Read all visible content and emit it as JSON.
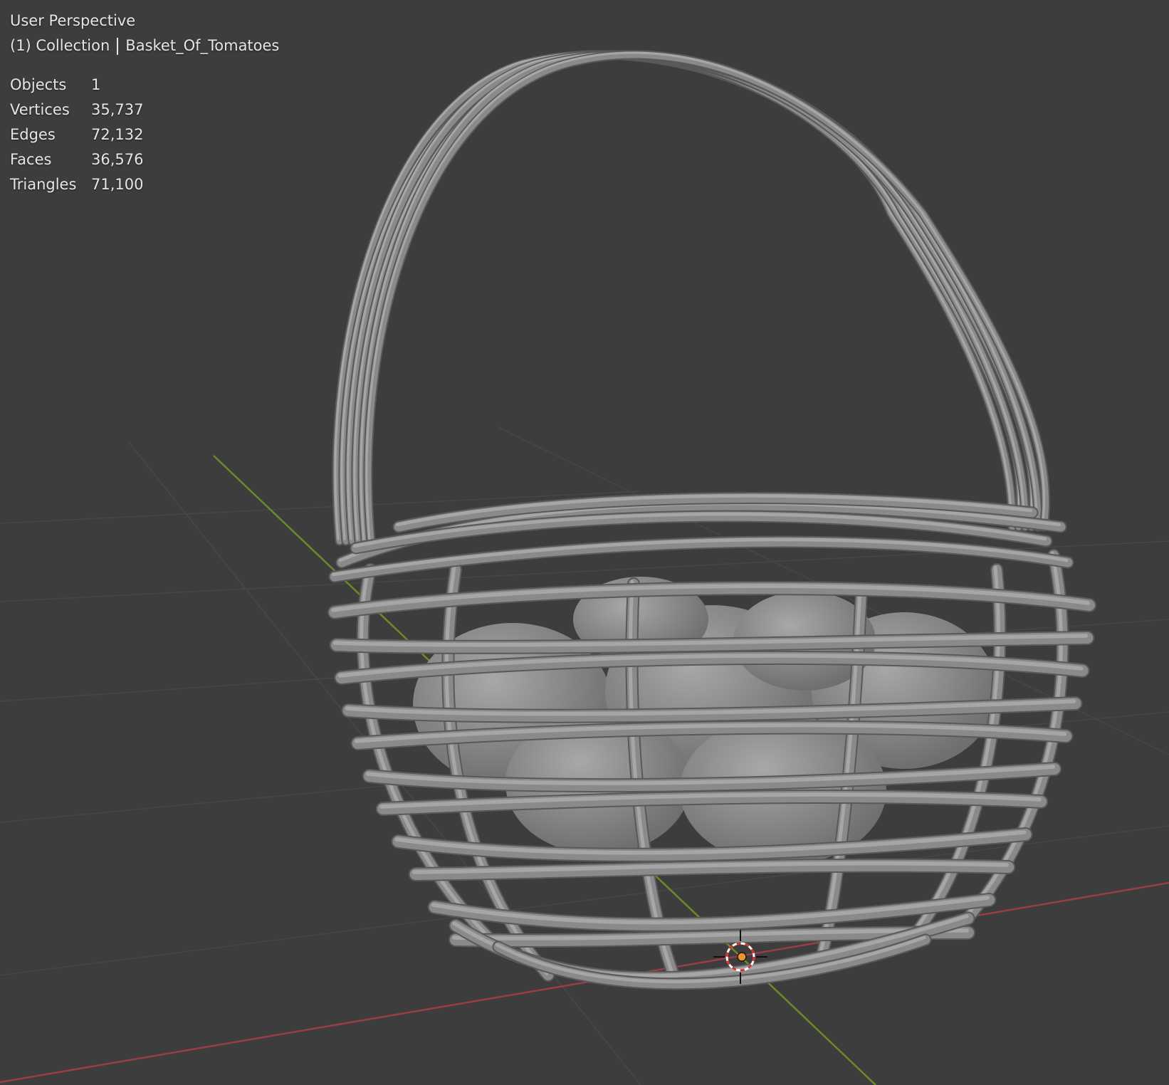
{
  "viewport": {
    "view_name": "User Perspective",
    "collection_prefix": "(1) Collection",
    "active_object": "Basket_Of_Tomatoes"
  },
  "stats": [
    {
      "label": "Objects",
      "value": "1"
    },
    {
      "label": "Vertices",
      "value": "35,737"
    },
    {
      "label": "Edges",
      "value": "72,132"
    },
    {
      "label": "Faces",
      "value": "36,576"
    },
    {
      "label": "Triangles",
      "value": "71,100"
    }
  ],
  "colors": {
    "background": "#3d3d3d",
    "grid_line": "#474747",
    "x_axis": "#9a3d46",
    "y_axis": "#6b8a2a",
    "mesh": "#8a8a8a",
    "mesh_highlight": "#a6a6a6",
    "mesh_shadow": "#595959",
    "origin": "#f0932e",
    "text": "#e6e6e6"
  },
  "icons": {
    "cursor": "3d-cursor-icon",
    "origin": "object-origin-icon"
  }
}
